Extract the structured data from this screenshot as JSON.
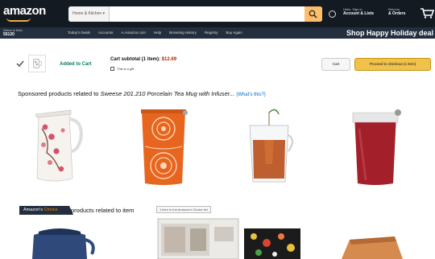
{
  "header": {
    "logo": "amazon",
    "search_category": "Home & Kitchen",
    "account": {
      "line1": "Hello, Sign in",
      "line2": "Account & Lists"
    },
    "orders": {
      "line1": "Returns",
      "line2": "& Orders"
    },
    "deliver": {
      "line1": "Deliver to Hello",
      "line2": "55120"
    },
    "subnav": [
      "Today's Deals",
      "Accounts",
      "A.Amazon.com",
      "Help",
      "Browsing History",
      "Registry",
      "Buy Again"
    ],
    "promo": "Shop Happy Holiday deal"
  },
  "cart_strip": {
    "added_label": "Added to Cart",
    "subtotal_label": "Cart subtotal (1 item):",
    "subtotal_price": "$12.69",
    "gift_label": "This is a gift",
    "cart_button": "Cart",
    "checkout_button": "Proceed to checkout (1 item)"
  },
  "sponsored": {
    "prefix": "Sponsored products related to ",
    "product": "Sweese 201.210 Porcelain Tea Mug with Infuser...",
    "whats_this": "(What's this?)"
  },
  "choice": {
    "badge_part1": "Amazon's",
    "badge_part2": "Choice",
    "text": "products related to item",
    "tooltip": "1 item in the Amazon's Choice list"
  },
  "icons": {
    "search": "search-icon",
    "cart": "cart-icon",
    "globe": "globe-icon",
    "check": "check-icon"
  },
  "colors": {
    "nav_dark": "#131a22",
    "nav_sub": "#232f3e",
    "search_button": "#febd69",
    "checkout_button": "#f0c14b",
    "added_green": "#067d62",
    "price_red": "#b12704",
    "link_blue": "#0066c0",
    "choice_orange": "#f08804"
  }
}
